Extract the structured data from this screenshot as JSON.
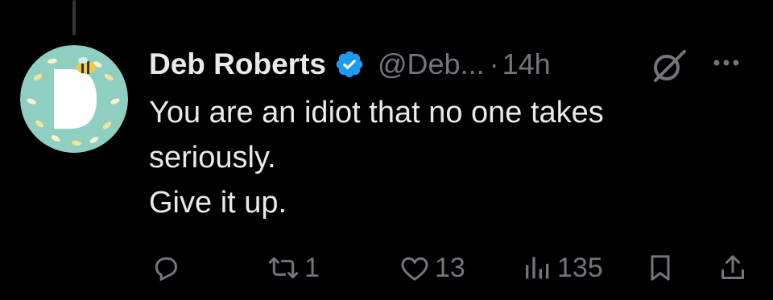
{
  "post": {
    "author": {
      "name": "Deb Roberts",
      "handle": "@Deb...",
      "verified": true,
      "avatar": "avatar-letter-d-with-bee"
    },
    "separator": "·",
    "time": "14h",
    "text_lines": [
      "You are an idiot that no one takes",
      "seriously.",
      "Give it up."
    ],
    "actions": {
      "reply": {
        "icon": "reply-icon",
        "count": ""
      },
      "repost": {
        "icon": "repost-icon",
        "count": "1"
      },
      "like": {
        "icon": "heart-icon",
        "count": "13"
      },
      "views": {
        "icon": "views-icon",
        "count": "135"
      },
      "bookmark": {
        "icon": "bookmark-icon"
      },
      "share": {
        "icon": "share-icon"
      }
    }
  },
  "colors": {
    "background": "#000000",
    "text": "#e7e9ea",
    "muted": "#71767b",
    "verified": "#1d9bf0",
    "avatar_bg": "#8fcfc2"
  }
}
